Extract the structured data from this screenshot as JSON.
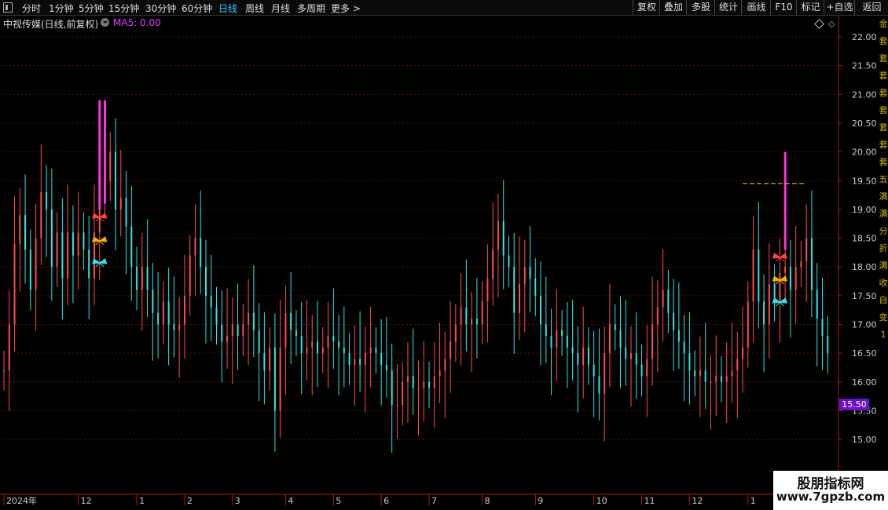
{
  "toolbar": {
    "periods": [
      {
        "label": "分时",
        "active": false
      },
      {
        "label": "1分钟",
        "active": false
      },
      {
        "label": "5分钟",
        "active": false
      },
      {
        "label": "15分钟",
        "active": false
      },
      {
        "label": "30分钟",
        "active": false
      },
      {
        "label": "60分钟",
        "active": false
      },
      {
        "label": "日线",
        "active": true
      },
      {
        "label": "周线",
        "active": false
      },
      {
        "label": "月线",
        "active": false
      },
      {
        "label": "多周期",
        "active": false
      },
      {
        "label": "更多 >",
        "active": false
      }
    ],
    "right_buttons": [
      "复权",
      "叠加",
      "多股",
      "统计",
      "画线",
      "F10",
      "标记",
      "+自选",
      "返回"
    ]
  },
  "header": {
    "stock_name": "中视传媒(日线,前复权)",
    "ma_label": "MA5: 0.00"
  },
  "colors": {
    "up": "#ff4d4d",
    "down": "#2ee6e6",
    "signal": "#ff33dd",
    "axis": "#b3191d",
    "grid": "#5a0d0d",
    "price_tag_bg": "#6a13c6",
    "dash_line": "#ffd24d"
  },
  "current_price_tag": "15.50",
  "side_strip_chars": [
    "金",
    "套",
    "套",
    "套",
    "套",
    "套",
    "套",
    "套",
    "套",
    "五",
    "满",
    "满",
    "分",
    "折",
    "满",
    "收",
    "自",
    "变",
    "1"
  ],
  "watermark": {
    "title": "股朋指标网",
    "url": "www.7gpzb.com"
  },
  "chart_data": {
    "type": "candlestick",
    "title": "",
    "ylim": [
      14.5,
      22.2
    ],
    "y_ticks": [
      "22.00",
      "21.50",
      "21.00",
      "20.50",
      "20.00",
      "19.50",
      "19.00",
      "18.50",
      "18.00",
      "17.50",
      "17.00",
      "16.50",
      "16.00",
      "15.50",
      "15.00"
    ],
    "x_ticks": [
      {
        "label": "2024年",
        "bar": 0
      },
      {
        "label": "12",
        "bar": 14
      },
      {
        "label": "1",
        "bar": 25
      },
      {
        "label": "2",
        "bar": 34
      },
      {
        "label": "3",
        "bar": 43
      },
      {
        "label": "4",
        "bar": 53
      },
      {
        "label": "5",
        "bar": 62
      },
      {
        "label": "6",
        "bar": 71
      },
      {
        "label": "7",
        "bar": 80
      },
      {
        "label": "8",
        "bar": 90
      },
      {
        "label": "9",
        "bar": 100
      },
      {
        "label": "10",
        "bar": 111
      },
      {
        "label": "11",
        "bar": 120
      },
      {
        "label": "12",
        "bar": 129
      },
      {
        "label": "1",
        "bar": 140
      }
    ],
    "close": [
      16.2,
      17.0,
      18.4,
      18.9,
      18.3,
      17.6,
      18.5,
      19.3,
      19.0,
      18.0,
      18.6,
      17.8,
      18.6,
      18.2,
      18.6,
      18.3,
      17.8,
      18.6,
      19.5,
      19.5,
      20.0,
      19.0,
      19.2,
      18.7,
      18.0,
      17.6,
      18.0,
      17.6,
      17.2,
      17.0,
      17.4,
      17.0,
      16.9,
      17.0,
      17.5,
      18.2,
      18.5,
      18.0,
      17.5,
      17.3,
      17.0,
      16.7,
      16.8,
      17.0,
      16.8,
      17.0,
      17.2,
      16.9,
      16.5,
      16.2,
      16.6,
      15.5,
      16.6,
      17.2,
      16.9,
      16.8,
      16.5,
      16.6,
      16.7,
      16.5,
      16.6,
      16.8,
      16.7,
      16.6,
      16.5,
      16.3,
      16.4,
      16.3,
      16.5,
      16.6,
      16.5,
      16.3,
      16.2,
      15.6,
      15.6,
      16.0,
      16.1,
      15.9,
      15.9,
      16.0,
      15.9,
      16.1,
      16.2,
      16.4,
      16.7,
      17.0,
      17.3,
      17.0,
      17.1,
      17.0,
      17.4,
      17.8,
      18.3,
      18.8,
      18.2,
      18.0,
      17.2,
      17.7,
      18.0,
      17.8,
      17.5,
      17.0,
      16.8,
      16.6,
      16.9,
      16.8,
      16.6,
      16.5,
      16.3,
      16.6,
      16.3,
      16.1,
      15.8,
      16.5,
      17.0,
      16.9,
      16.6,
      16.4,
      16.5,
      16.3,
      16.1,
      16.4,
      17.0,
      17.3,
      17.6,
      17.2,
      16.9,
      16.7,
      16.5,
      16.2,
      16.1,
      16.2,
      16.0,
      16.0,
      16.1,
      16.0,
      16.1,
      16.2,
      16.4,
      16.6,
      17.4,
      18.3,
      17.4,
      17.0,
      17.7,
      17.4,
      17.9,
      18.0,
      17.6,
      18.0,
      18.1,
      18.5,
      17.6,
      17.1,
      16.8,
      16.5
    ],
    "signal_bars": [
      {
        "bar": 18,
        "high": 20.9,
        "low": 19.0
      },
      {
        "bar": 19,
        "high": 20.9,
        "low": 19.1
      },
      {
        "bar": 147,
        "high": 20.0,
        "low": 18.3
      }
    ],
    "reference_line": {
      "value": 19.45,
      "from_bar": 139,
      "to_bar": 151
    }
  }
}
